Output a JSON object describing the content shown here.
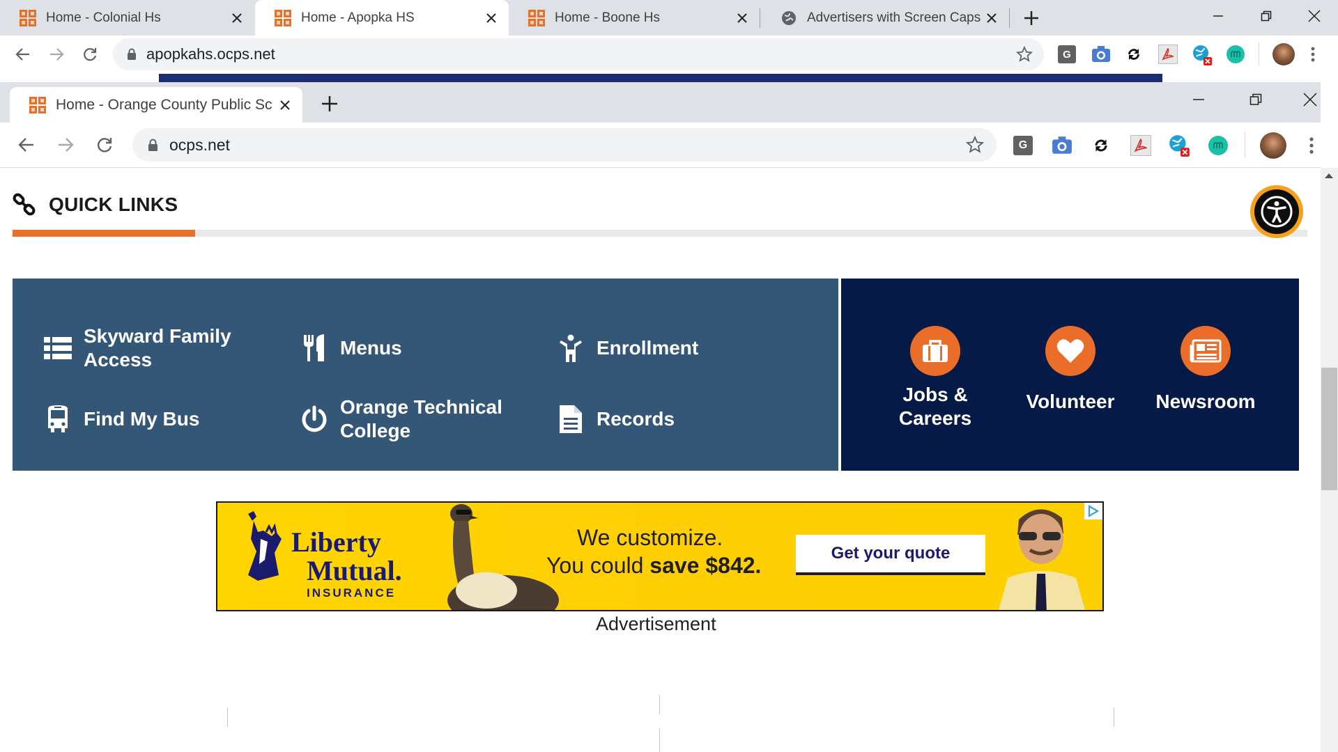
{
  "outer_browser": {
    "tabs": [
      {
        "title": "Home - Colonial Hs",
        "active": false
      },
      {
        "title": "Home - Apopka HS",
        "active": true
      },
      {
        "title": "Home - Boone Hs",
        "active": false
      },
      {
        "title": "Advertisers with Screen Caps of t",
        "active": false
      }
    ],
    "url": "apopkahs.ocps.net"
  },
  "inner_browser": {
    "tabs": [
      {
        "title": "Home - Orange County Public Sc",
        "active": true
      }
    ],
    "url": "ocps.net"
  },
  "extensions": [
    "G"
  ],
  "quick_links": {
    "title": "QUICK LINKS",
    "links": [
      {
        "label": "Skyward Family Access",
        "icon": "list-icon"
      },
      {
        "label": "Menus",
        "icon": "utensils-icon"
      },
      {
        "label": "Enrollment",
        "icon": "child-icon"
      },
      {
        "label": "Find My Bus",
        "icon": "bus-icon"
      },
      {
        "label": "Orange Technical College",
        "icon": "power-icon"
      },
      {
        "label": "Records",
        "icon": "document-icon"
      }
    ],
    "features": [
      {
        "label": "Jobs & Careers",
        "icon": "briefcase-icon"
      },
      {
        "label": "Volunteer",
        "icon": "heart-icon"
      },
      {
        "label": "Newsroom",
        "icon": "newspaper-icon"
      }
    ]
  },
  "ad": {
    "brand_line1": "Liberty",
    "brand_line2": "Mutual.",
    "brand_line3": "INSURANCE",
    "headline": "We customize.",
    "subline_prefix": "You could ",
    "subline_bold": "save $842.",
    "cta": "Get your quote",
    "label": "Advertisement"
  },
  "colors": {
    "tabstrip": "#dee1e6",
    "links_panel": "#355777",
    "feature_panel": "#051a47",
    "accent_orange": "#ea6d2a",
    "ad_yellow": "#ffd500"
  }
}
